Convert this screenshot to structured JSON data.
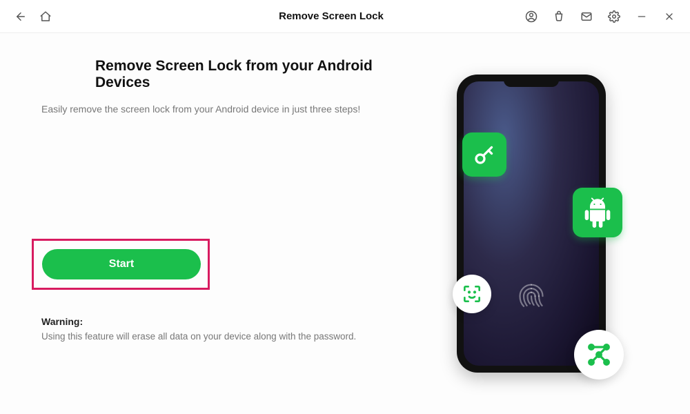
{
  "header": {
    "title": "Remove Screen Lock"
  },
  "main": {
    "heading": "Remove Screen Lock from your Android Devices",
    "subtext": "Easily remove the screen lock from your Android device in just three steps!",
    "start_label": "Start",
    "warning_label": "Warning:",
    "warning_text": "Using this feature will erase all data on your device along with the password."
  },
  "icons": {
    "back": "back-icon",
    "home": "home-icon",
    "user": "user-icon",
    "cart": "cart-icon",
    "mail": "mail-icon",
    "settings": "gear-icon",
    "minimize": "minimize-icon",
    "close": "close-icon",
    "key": "key-icon",
    "android": "android-icon",
    "face": "face-id-icon",
    "pattern": "pattern-icon",
    "fingerprint": "fingerprint-icon"
  },
  "colors": {
    "accent": "#1bbf4c",
    "highlight": "#d81b60"
  }
}
